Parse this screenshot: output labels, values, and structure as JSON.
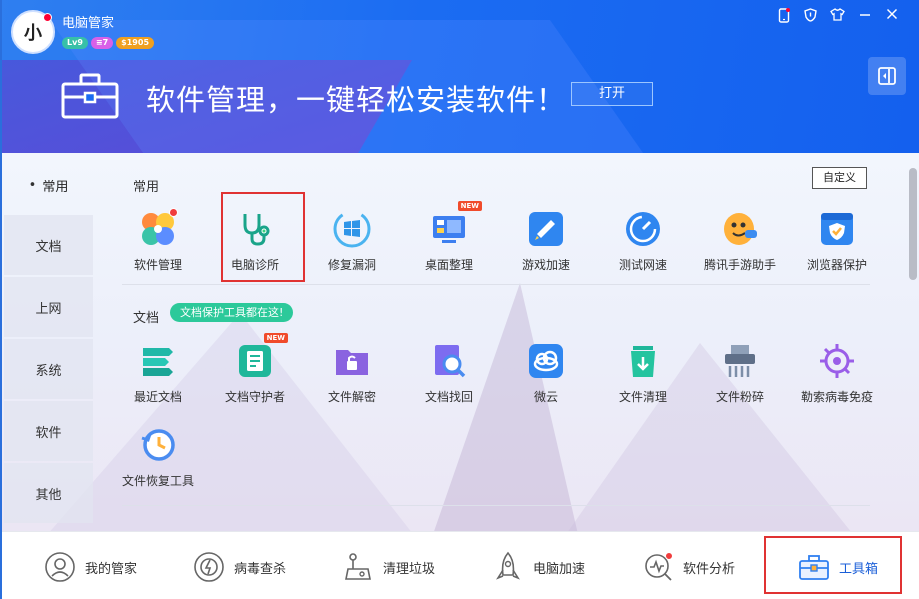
{
  "app": {
    "title": "电脑管家",
    "avatar_text": "小",
    "level_badge": "Lv9",
    "vip_badge": "≡7",
    "coin_badge": "$1905"
  },
  "window_controls": [
    "phone-icon",
    "shield-icon",
    "shirt-icon",
    "minimize-icon",
    "close-icon"
  ],
  "banner": {
    "text": "软件管理，一键轻松安装软件！",
    "open_button": "打开",
    "icon": "toolbox-icon"
  },
  "sidebar": {
    "items": [
      {
        "label": "常用",
        "active": true
      },
      {
        "label": "文档"
      },
      {
        "label": "上网"
      },
      {
        "label": "系统"
      },
      {
        "label": "软件"
      },
      {
        "label": "其他"
      }
    ]
  },
  "sections": {
    "common": {
      "label": "常用",
      "custom_button": "自定义",
      "tools": [
        {
          "label": "软件管理",
          "icon": "clover-icon",
          "dot": true
        },
        {
          "label": "电脑诊所",
          "icon": "stethoscope-icon",
          "highlighted": true
        },
        {
          "label": "修复漏洞",
          "icon": "windows-repair-icon"
        },
        {
          "label": "桌面整理",
          "icon": "desktop-icon",
          "new": "NEW"
        },
        {
          "label": "游戏加速",
          "icon": "game-boost-icon"
        },
        {
          "label": "测试网速",
          "icon": "speedometer-icon"
        },
        {
          "label": "腾讯手游助手",
          "icon": "game-assistant-icon"
        },
        {
          "label": "浏览器保护",
          "icon": "browser-shield-icon"
        }
      ]
    },
    "docs": {
      "label": "文档",
      "tip": "文档保护工具都在这!",
      "tools": [
        {
          "label": "最近文档",
          "icon": "recent-docs-icon"
        },
        {
          "label": "文档守护者",
          "icon": "doc-guard-icon",
          "new": "NEW"
        },
        {
          "label": "文件解密",
          "icon": "folder-decrypt-icon"
        },
        {
          "label": "文档找回",
          "icon": "doc-recover-icon"
        },
        {
          "label": "微云",
          "icon": "weiyun-icon"
        },
        {
          "label": "文件清理",
          "icon": "file-clean-icon"
        },
        {
          "label": "文件粉碎",
          "icon": "shredder-icon"
        },
        {
          "label": "勒索病毒免疫",
          "icon": "ransomware-icon"
        },
        {
          "label": "文件恢复工具",
          "icon": "file-restore-icon"
        }
      ]
    }
  },
  "bottom_nav": [
    {
      "label": "我的管家",
      "icon": "butler-icon"
    },
    {
      "label": "病毒查杀",
      "icon": "virus-scan-icon"
    },
    {
      "label": "清理垃圾",
      "icon": "vacuum-icon"
    },
    {
      "label": "电脑加速",
      "icon": "rocket-icon"
    },
    {
      "label": "软件分析",
      "icon": "analysis-icon",
      "dot": true
    },
    {
      "label": "工具箱",
      "icon": "toolbox-icon",
      "active": true
    }
  ],
  "colors": {
    "header": "#1b6cf2",
    "accent_green": "#2cc99a",
    "highlight_red": "#e03232"
  }
}
